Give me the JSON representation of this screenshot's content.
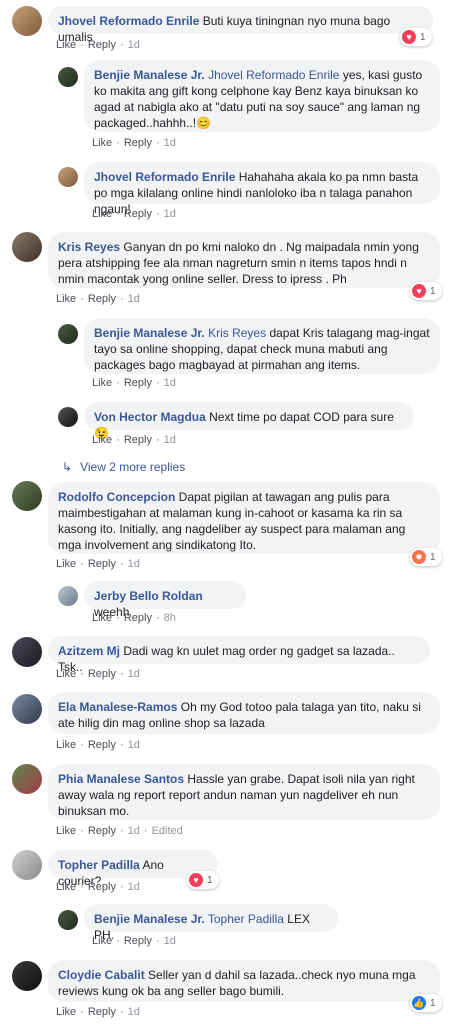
{
  "actions": {
    "like": "Like",
    "reply": "Reply",
    "edited": "Edited"
  },
  "more_replies": "View 2 more replies",
  "comments": [
    {
      "author": "Jhovel Reformado Enrile",
      "text": "Buti kuya tiningnan nyo muna bago umalis",
      "time": "1d",
      "reaction_count": "1",
      "reaction_icon": "heart-icon"
    },
    {
      "author": "Benjie Manalese Jr.",
      "mention": "Jhovel Reformado Enrile",
      "text": "yes, kasi gusto ko makita ang gift kong celphone kay Benz kaya binuksan ko agad at nabigla ako at \"datu puti na soy sauce\" ang laman ng packaged..hahhh..!😊",
      "time": "1d"
    },
    {
      "author": "Jhovel Reformado Enrile",
      "text": "Hahahaha akala ko pa nmn basta po mga kilalang online hindi nanloloko iba n talaga panahon ngaun!",
      "time": "1d"
    },
    {
      "author": "Kris Reyes",
      "text": "Ganyan dn po kmi naloko dn . Ng maipadala nmin yong pera atshipping fee ala nman nagreturn smin n items tapos hndi n nmin macontak yong online seller. Dress to ipress . Ph",
      "time": "1d",
      "reaction_count": "1",
      "reaction_icon": "heart-icon"
    },
    {
      "author": "Benjie Manalese Jr.",
      "mention": "Kris Reyes",
      "text": "dapat Kris talagang mag-ingat tayo sa online shopping, dapat check muna mabuti ang packages bago magbayad at pirmahan ang items.",
      "time": "1d"
    },
    {
      "author": "Von Hector Magdua",
      "text": "Next time po dapat COD para sure😉",
      "time": "1d"
    },
    {
      "author": "Rodolfo Concepcion",
      "text": "Dapat pigilan at tawagan ang pulis para maimbestigahan at malaman kung in-cahoot or kasama ka rin sa kasong ito. Initially, ang nagdeliber ay suspect para malaman ang mga involvement ang sindikatong Ito.",
      "time": "1d",
      "reaction_count": "1",
      "reaction_icon": "angry-icon"
    },
    {
      "author": "Jerby Bello Roldan",
      "text": "weehh",
      "time": "8h"
    },
    {
      "author": "Azitzem Mj",
      "text": "Dadi wag kn uulet mag order ng gadget sa lazada.. Tsk..",
      "time": "1d"
    },
    {
      "author": "Ela Manalese-Ramos",
      "text": "Oh my God totoo pala talaga yan tito, naku si ate hilig din mag online shop sa lazada",
      "time": "1d"
    },
    {
      "author": "Phia Manalese Santos",
      "text": "Hassle yan grabe. Dapat isoli nila yan right away wala ng report report andun naman yun nagdeliver eh nun binuksan mo.",
      "time": "1d"
    },
    {
      "author": "Topher Padilla",
      "text": "Ano courier?",
      "time": "1d",
      "reaction_count": "1",
      "reaction_icon": "heart-icon"
    },
    {
      "author": "Benjie Manalese Jr.",
      "mention": "Topher Padilla",
      "text": "LEX PH.",
      "time": "1d"
    },
    {
      "author": "Cloydie Cabalit",
      "text": "Seller yan d dahil sa lazada..check nyo muna mga reviews kung ok ba ang seller bago bumili.",
      "time": "1d",
      "reaction_count": "1",
      "reaction_icon": "like-icon"
    }
  ],
  "colors": {
    "author": "#385898",
    "bubble": "#f2f3f5",
    "heart": "#f33e58",
    "like": "#1877f2",
    "angry": "#f7714b"
  }
}
